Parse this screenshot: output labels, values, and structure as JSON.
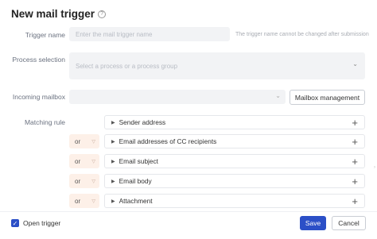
{
  "dialog": {
    "title": "New mail trigger",
    "help_icon": "?"
  },
  "trigger_name": {
    "label": "Trigger name",
    "placeholder": "Enter the mail trigger name",
    "hint": "The trigger name cannot be changed after submission"
  },
  "process_selection": {
    "label": "Process selection",
    "placeholder": "Select a process or a process group"
  },
  "incoming_mailbox": {
    "label": "Incoming mailbox",
    "value": "",
    "button": "Mailbox management"
  },
  "matching_rule": {
    "label": "Matching rule",
    "rows": [
      {
        "operator": "",
        "label": "Sender address"
      },
      {
        "operator": "or",
        "label": "Email addresses of CC recipients"
      },
      {
        "operator": "or",
        "label": "Email subject"
      },
      {
        "operator": "or",
        "label": "Email body"
      },
      {
        "operator": "or",
        "label": "Attachment"
      }
    ]
  },
  "footer": {
    "open_trigger_label": "Open trigger",
    "open_trigger_checked": true,
    "save": "Save",
    "cancel": "Cancel"
  },
  "colors": {
    "primary": "#2b4fc7",
    "or_bg": "#fdf0e8",
    "input_bg": "#f2f3f5"
  }
}
